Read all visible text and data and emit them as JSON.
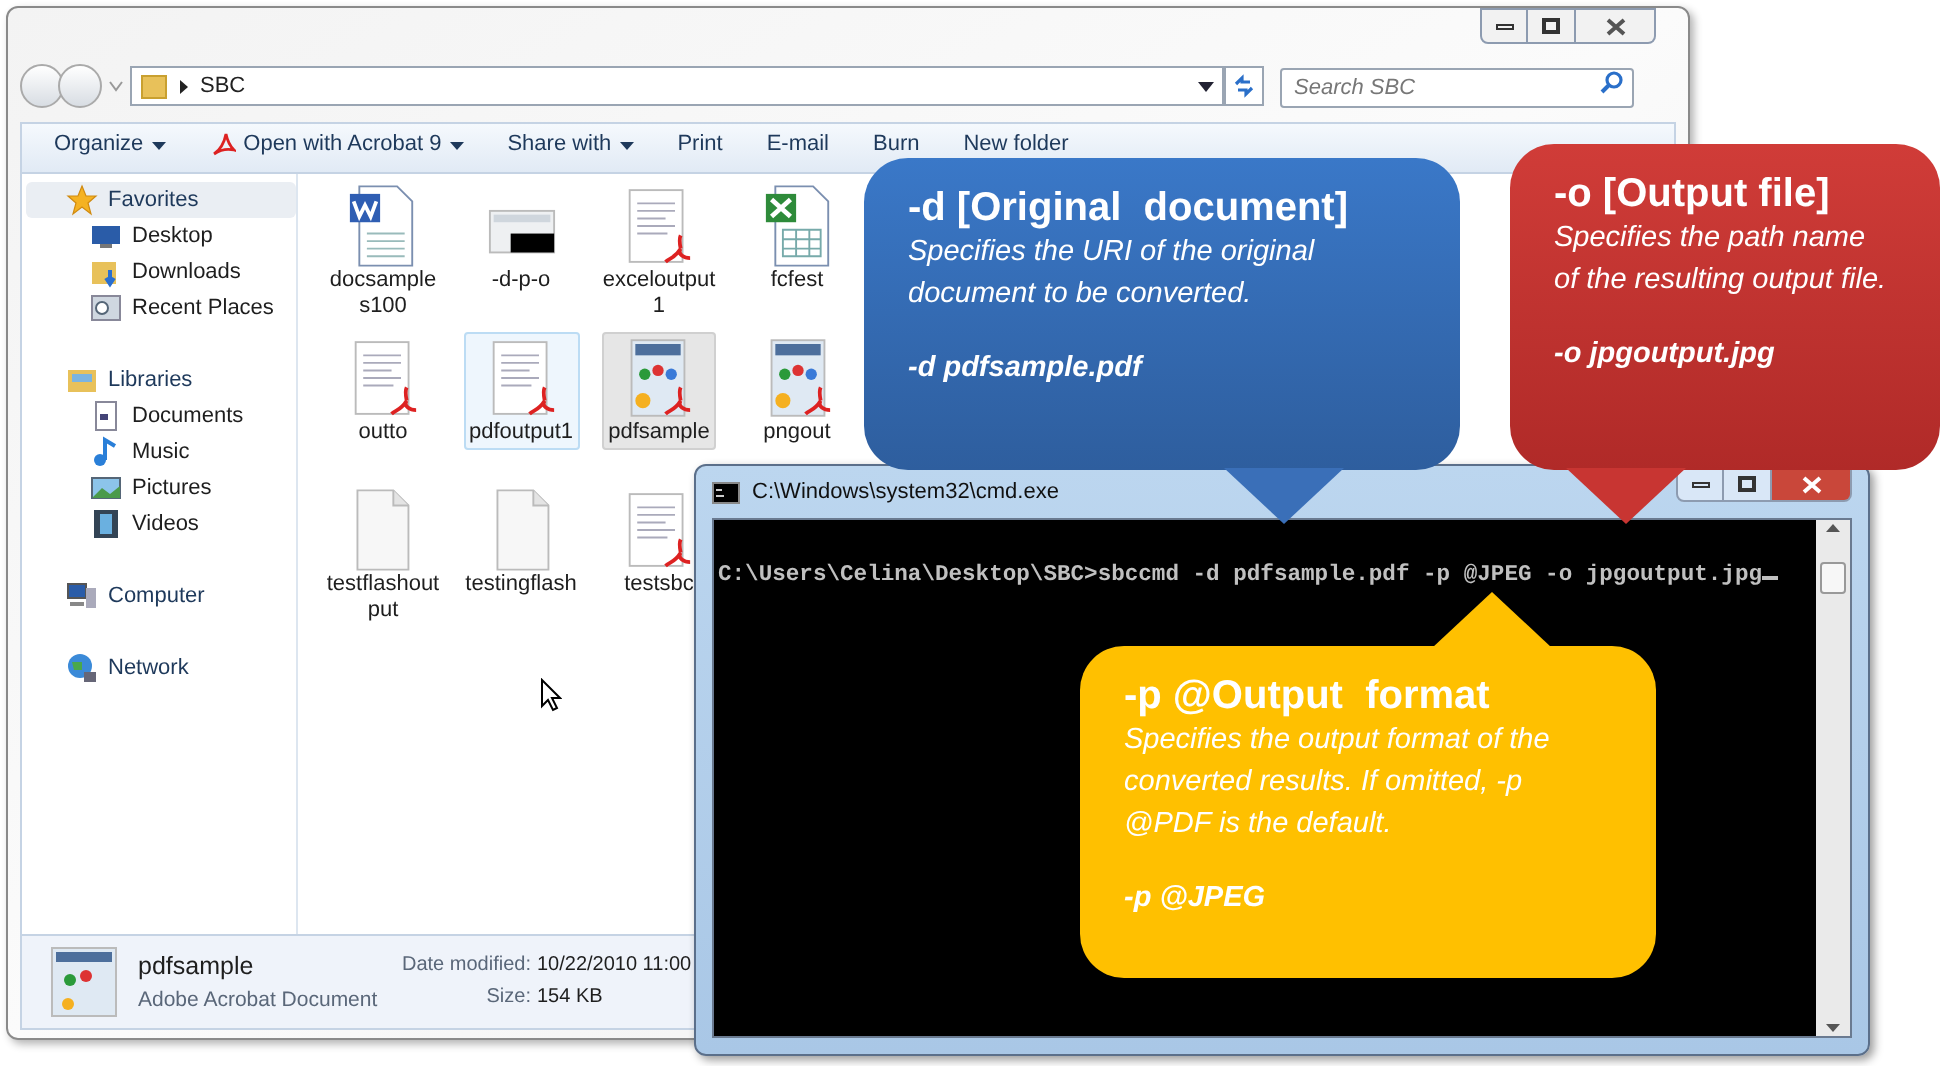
{
  "explorer": {
    "address": "SBC",
    "search": {
      "placeholder": "Search SBC"
    },
    "toolbar": [
      {
        "label": "Organize",
        "dropdown": true
      },
      {
        "label": "Open with Acrobat 9",
        "dropdown": true
      },
      {
        "label": "Share with",
        "dropdown": true
      },
      {
        "label": "Print",
        "dropdown": false
      },
      {
        "label": "E-mail",
        "dropdown": false
      },
      {
        "label": "Burn",
        "dropdown": false
      },
      {
        "label": "New folder",
        "dropdown": false
      }
    ],
    "sidebar": [
      {
        "label": "Favorites",
        "selected": true,
        "children": [
          {
            "label": "Desktop",
            "selected": false
          },
          {
            "label": "Downloads",
            "selected": false
          },
          {
            "label": "Recent Places",
            "selected": false
          }
        ]
      },
      {
        "label": "Libraries",
        "selected": false,
        "children": [
          {
            "label": "Documents",
            "selected": false
          },
          {
            "label": "Music",
            "selected": false
          },
          {
            "label": "Pictures",
            "selected": false
          },
          {
            "label": "Videos",
            "selected": false
          }
        ]
      },
      {
        "label": "Computer",
        "selected": false
      },
      {
        "label": "Network",
        "selected": false
      }
    ],
    "file_rows": [
      {
        "items": [
          {
            "lines": [
              "docsample",
              "s100"
            ],
            "kind": "word",
            "selected": false,
            "hovered": false
          },
          {
            "lines": [
              "-d-p-o"
            ],
            "kind": "screenshot",
            "selected": false,
            "hovered": false
          },
          {
            "lines": [
              "exceloutput",
              "1"
            ],
            "kind": "pdf",
            "selected": false,
            "hovered": false
          },
          {
            "lines": [
              "fcfest"
            ],
            "kind": "excel",
            "selected": false,
            "hovered": false
          }
        ]
      },
      {
        "items": [
          {
            "lines": [
              "outto"
            ],
            "kind": "pdf",
            "selected": false,
            "hovered": false
          },
          {
            "lines": [
              "pdfoutput1"
            ],
            "kind": "pdf",
            "selected": false,
            "hovered": true
          },
          {
            "lines": [
              "pdfsample"
            ],
            "kind": "brochure",
            "selected": true,
            "hovered": false
          },
          {
            "lines": [
              "pngout"
            ],
            "kind": "brochure",
            "selected": false,
            "hovered": false
          }
        ]
      },
      {
        "items": [
          {
            "lines": [
              "testflashout",
              "put"
            ],
            "kind": "blank",
            "selected": false,
            "hovered": false
          },
          {
            "lines": [
              "testingflash"
            ],
            "kind": "blank",
            "selected": false,
            "hovered": false
          },
          {
            "lines": [
              "testsbc"
            ],
            "kind": "pdf",
            "selected": false,
            "hovered": false
          }
        ]
      }
    ],
    "details": {
      "name": "pdfsample",
      "type": "Adobe Acrobat Document",
      "date_label": "Date modified:",
      "date": "10/22/2010 11:00",
      "size_label": "Size:",
      "size": "154 KB"
    }
  },
  "console": {
    "title": "C:\\Windows\\system32\\cmd.exe",
    "line": "C:\\Users\\Celina\\Desktop\\SBC>sbccmd -d pdfsample.pdf -p @JPEG -o jpgoutput.jpg"
  },
  "callouts": [
    {
      "kind": "blue",
      "color": "#3a6fb8",
      "title": "-d [Original  document]",
      "description": "Specifies the URI of the original document to be converted.",
      "example": "-d pdfsample.pdf"
    },
    {
      "kind": "red",
      "color": "#c83532",
      "title": "-o [Output file]",
      "description": "Specifies the path name of the resulting output file.",
      "example": "-o jpgoutput.jpg"
    },
    {
      "kind": "yellow",
      "color": "#ffc000",
      "title": "-p @Output  format",
      "description": "Specifies the output format of the converted results. If omitted, -p @PDF is the default.",
      "example": "-p @JPEG"
    }
  ]
}
